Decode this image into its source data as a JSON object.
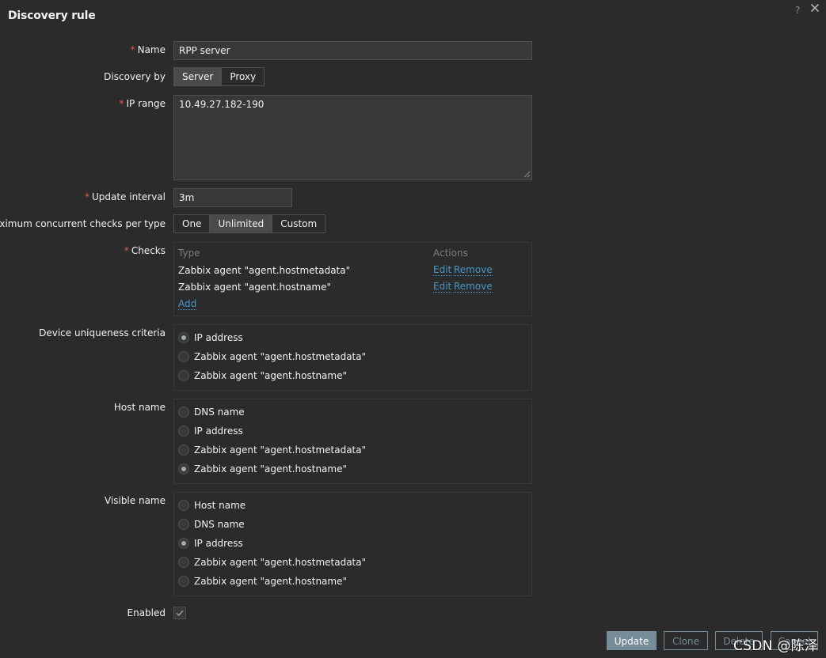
{
  "dialog": {
    "title": "Discovery rule",
    "help": "?"
  },
  "form": {
    "name": {
      "label": "Name",
      "value": "RPP server"
    },
    "discovery_by": {
      "label": "Discovery by",
      "options": [
        "Server",
        "Proxy"
      ],
      "selected": "Server"
    },
    "ip_range": {
      "label": "IP range",
      "value": "10.49.27.182-190"
    },
    "update_interval": {
      "label": "Update interval",
      "value": "3m"
    },
    "max_checks": {
      "label": "Maximum concurrent checks per type",
      "options": [
        "One",
        "Unlimited",
        "Custom"
      ],
      "selected": "Unlimited"
    },
    "checks": {
      "label": "Checks",
      "headers": {
        "type": "Type",
        "actions": "Actions"
      },
      "rows": [
        {
          "type": "Zabbix agent \"agent.hostmetadata\"",
          "edit": "Edit",
          "remove": "Remove"
        },
        {
          "type": "Zabbix agent \"agent.hostname\"",
          "edit": "Edit",
          "remove": "Remove"
        }
      ],
      "add": "Add"
    },
    "uniqueness": {
      "label": "Device uniqueness criteria",
      "options": [
        "IP address",
        "Zabbix agent \"agent.hostmetadata\"",
        "Zabbix agent \"agent.hostname\""
      ],
      "selected": "IP address"
    },
    "host_name": {
      "label": "Host name",
      "options": [
        "DNS name",
        "IP address",
        "Zabbix agent \"agent.hostmetadata\"",
        "Zabbix agent \"agent.hostname\""
      ],
      "selected": "Zabbix agent \"agent.hostname\""
    },
    "visible_name": {
      "label": "Visible name",
      "options": [
        "Host name",
        "DNS name",
        "IP address",
        "Zabbix agent \"agent.hostmetadata\"",
        "Zabbix agent \"agent.hostname\""
      ],
      "selected": "IP address"
    },
    "enabled": {
      "label": "Enabled",
      "checked": true
    }
  },
  "footer": {
    "update": "Update",
    "clone": "Clone",
    "delete": "Delete",
    "cancel": "Cancel"
  },
  "watermark": "CSDN @陈泽",
  "colors": {
    "background": "#2b2b2b",
    "input": "#383838",
    "border": "#4f4f4f",
    "link": "#4796c4",
    "required": "#e45959",
    "primary_button": "#768d99"
  }
}
